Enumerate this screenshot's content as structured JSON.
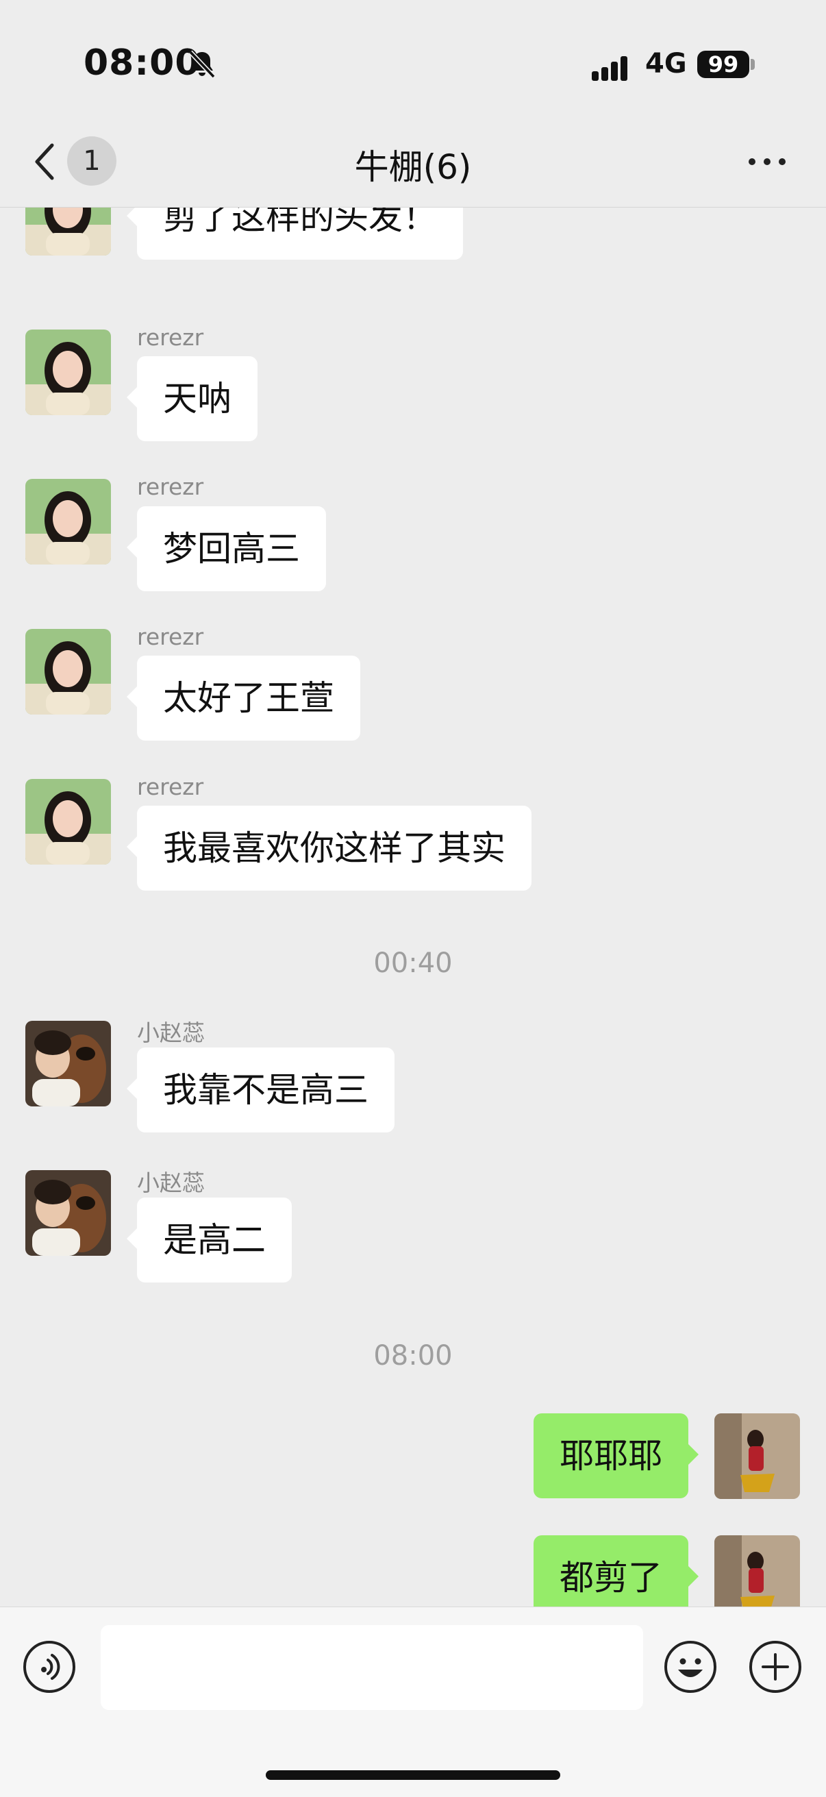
{
  "status_bar": {
    "time": "08:00",
    "network": "4G",
    "battery": "99",
    "icons": [
      "bell-muted-icon",
      "signal-icon",
      "battery-icon"
    ]
  },
  "nav": {
    "back_icon": "chevron-left-icon",
    "unread_count": "1",
    "title": "牛棚(6)",
    "more_icon": "more-dots-icon"
  },
  "messages": [
    {
      "side": "in",
      "sender": "",
      "avatar": "avatar-woman",
      "text": "剪了这样的头发！"
    },
    {
      "side": "in",
      "sender": "rerezr",
      "avatar": "avatar-woman",
      "text": "天呐"
    },
    {
      "side": "in",
      "sender": "rerezr",
      "avatar": "avatar-woman",
      "text": "梦回高三"
    },
    {
      "side": "in",
      "sender": "rerezr",
      "avatar": "avatar-woman",
      "text": "太好了王萱"
    },
    {
      "side": "in",
      "sender": "rerezr",
      "avatar": "avatar-woman",
      "text": "我最喜欢你这样了其实"
    },
    {
      "timestamp": "00:40"
    },
    {
      "side": "in",
      "sender": "小赵蕊",
      "avatar": "avatar-child-dog",
      "text": "我靠不是高三"
    },
    {
      "side": "in",
      "sender": "小赵蕊",
      "avatar": "avatar-child-dog",
      "text": "是高二"
    },
    {
      "timestamp": "08:00"
    },
    {
      "side": "out",
      "avatar": "avatar-self",
      "text": "耶耶耶"
    },
    {
      "side": "out",
      "avatar": "avatar-self",
      "text": "都剪了"
    }
  ],
  "input_bar": {
    "voice_icon": "voice-icon",
    "text_value": "",
    "emoji_icon": "emoji-icon",
    "add_icon": "plus-icon"
  },
  "colors": {
    "background": "#ededed",
    "incoming_bubble": "#ffffff",
    "outgoing_bubble": "#95ec69",
    "sender_name": "#8a8a8a",
    "timestamp": "#9e9e9e"
  }
}
